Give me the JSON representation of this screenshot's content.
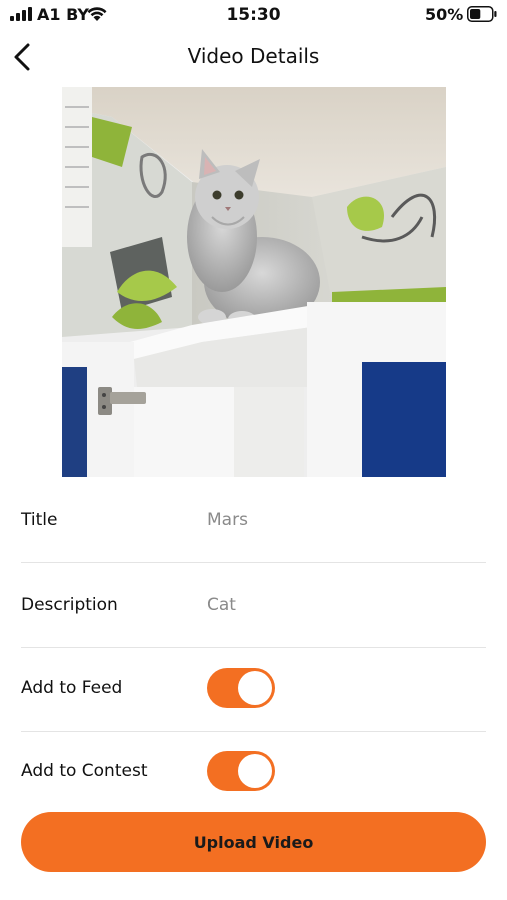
{
  "status_bar": {
    "carrier": "A1 BY",
    "time": "15:30",
    "battery_percent": "50%",
    "battery_level": 0.5
  },
  "header": {
    "title": "Video Details",
    "back_icon": "chevron-left-icon"
  },
  "form": {
    "title": {
      "label": "Title",
      "value": "Mars"
    },
    "description": {
      "label": "Description",
      "value": "Cat"
    },
    "add_to_feed": {
      "label": "Add to Feed",
      "on": true
    },
    "add_to_contest": {
      "label": "Add to Contest",
      "on": true
    }
  },
  "upload_button": {
    "label": "Upload Video"
  },
  "colors": {
    "accent": "#f36f22",
    "muted_text": "#8a8a8a",
    "divider": "#e4e4e4"
  }
}
